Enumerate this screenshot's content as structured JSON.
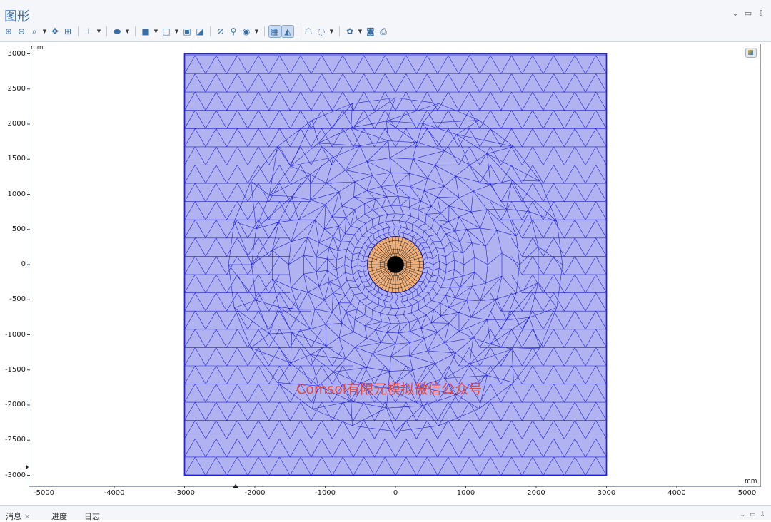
{
  "panel": {
    "title": "图形"
  },
  "window_controls": {
    "collapse": "⌄",
    "maximize": "▭",
    "pin": "⇩"
  },
  "toolbar_icons": [
    "zoom-in-icon",
    "zoom-out-icon",
    "zoom-box-icon",
    "zoom-dropdown",
    "zoom-extents-icon",
    "zoom-selected-icon",
    "axis-orientation-icon",
    "axis-dropdown",
    "select-mode-icon",
    "select-mode-dropdown",
    "selection-box-icon",
    "selection-dropdown",
    "select-none-icon",
    "select-all-icon",
    "hide-icon",
    "hide-selected-icon",
    "view-icon",
    "view-dropdown",
    "wireframe-icon",
    "mesh-rendering-icon",
    "scene-light-icon",
    "transparency-icon",
    "transparency-dropdown",
    "reset-view-icon",
    "reset-dropdown",
    "camera-icon",
    "print-icon"
  ],
  "plot": {
    "unit_top": "mm",
    "unit_right": "mm",
    "y_ticks": [
      "3000",
      "2500",
      "2000",
      "1500",
      "1000",
      "500",
      "0",
      "-500",
      "-1000",
      "-1500",
      "-2000",
      "-2500",
      "-3000"
    ],
    "x_ticks": [
      "-5000",
      "-4000",
      "-3000",
      "-2000",
      "-1000",
      "0",
      "1000",
      "2000",
      "3000",
      "4000",
      "5000"
    ],
    "y_range": [
      -3000,
      3000
    ],
    "x_range": [
      -5000,
      5000
    ],
    "domain_size": 6000,
    "circle_outer_radius": 400,
    "circle_inner_radius": 100,
    "domain_color": "#b0b3f0",
    "mesh_color": "#2020e0",
    "circle_color": "#f2b07a"
  },
  "watermark": "Comsol有限元模拟微信公众号",
  "bottom_tabs": [
    {
      "label": "消息"
    },
    {
      "label": "进度"
    },
    {
      "label": "日志"
    }
  ]
}
